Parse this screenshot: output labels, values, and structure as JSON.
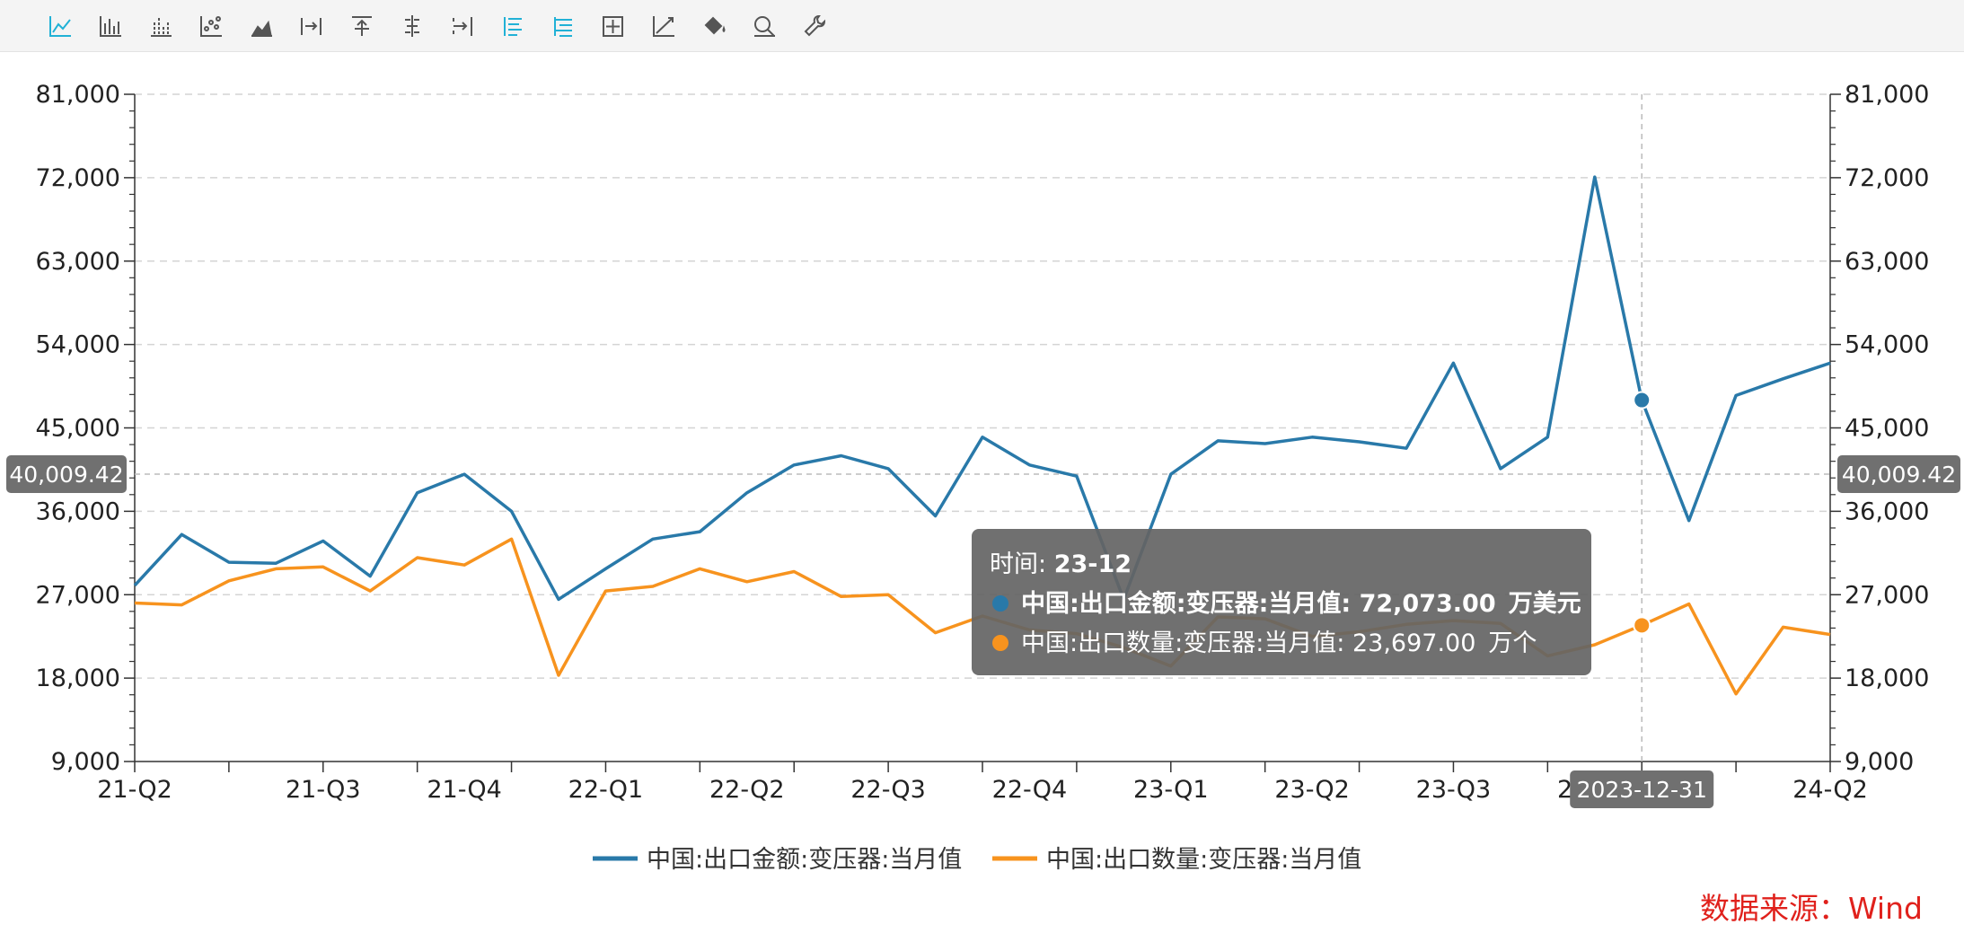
{
  "toolbar": {
    "buttons": [
      {
        "name": "line-chart-icon",
        "active": true
      },
      {
        "name": "bar-chart-icon",
        "active": false
      },
      {
        "name": "stacked-bar-icon",
        "active": false
      },
      {
        "name": "scatter-chart-icon",
        "active": false
      },
      {
        "name": "area-chart-icon",
        "active": false
      },
      {
        "name": "align-right-icon",
        "active": false
      },
      {
        "name": "align-top-icon",
        "active": false
      },
      {
        "name": "align-center-icon",
        "active": false
      },
      {
        "name": "align-end-icon",
        "active": false
      },
      {
        "name": "list-left-icon",
        "active": true
      },
      {
        "name": "list-right-icon",
        "active": true
      },
      {
        "name": "crosshair-box-icon",
        "active": false
      },
      {
        "name": "trend-line-icon",
        "active": false
      },
      {
        "name": "fill-bucket-icon",
        "active": false
      },
      {
        "name": "zoom-icon",
        "active": false
      },
      {
        "name": "wrench-icon",
        "active": false
      }
    ]
  },
  "chart_data": {
    "type": "line",
    "x": [
      "21-04",
      "21-05",
      "21-06",
      "21-07",
      "21-08",
      "21-09",
      "21-10",
      "21-11",
      "21-12",
      "22-01",
      "22-02",
      "22-03",
      "22-04",
      "22-05",
      "22-06",
      "22-07",
      "22-08",
      "22-09",
      "22-10",
      "22-11",
      "22-12",
      "23-01",
      "23-02",
      "23-03",
      "23-04",
      "23-05",
      "23-06",
      "23-07",
      "23-08",
      "23-09",
      "23-10",
      "23-11",
      "23-12",
      "24-01",
      "24-02",
      "24-03",
      "24-04"
    ],
    "x_tick_labels": [
      "21-Q2",
      "21-Q3",
      "21-Q4",
      "22-Q1",
      "22-Q2",
      "22-Q3",
      "22-Q4",
      "23-Q1",
      "23-Q2",
      "23-Q3",
      "23-Q4",
      "24-Q2"
    ],
    "x_tick_positions": [
      "21-04",
      "21-08",
      "21-11",
      "22-02",
      "22-05",
      "22-08",
      "22-11",
      "23-02",
      "23-05",
      "23-08",
      "23-11",
      "24-04"
    ],
    "y_left": {
      "min": 9000,
      "max": 81000,
      "ticks": [
        "9,000",
        "18,000",
        "27,000",
        "36,000",
        "45,000",
        "54,000",
        "63,000",
        "72,000",
        "81,000"
      ]
    },
    "y_right": {
      "min": 9000,
      "max": 81000,
      "ticks": [
        "9,000",
        "18,000",
        "27,000",
        "36,000",
        "45,000",
        "54,000",
        "63,000",
        "72,000",
        "81,000"
      ]
    },
    "series": [
      {
        "name": "中国:出口金额:变压器:当月值",
        "color": "#2979a9",
        "values": [
          28000,
          33500,
          30500,
          30400,
          32800,
          29000,
          38000,
          40000,
          36000,
          26500,
          29800,
          33000,
          33800,
          38000,
          41000,
          42000,
          40600,
          35500,
          44000,
          41000,
          39800,
          26500,
          40000,
          43600,
          43300,
          44000,
          43500,
          42800,
          52000,
          40600,
          44000,
          72073,
          48000,
          35000,
          48500,
          50300,
          52000
        ]
      },
      {
        "name": "中国:出口数量:变压器:当月值",
        "color": "#f7931e",
        "values": [
          26100,
          25900,
          28500,
          29800,
          30000,
          27400,
          31000,
          30200,
          33000,
          18300,
          27400,
          27900,
          29800,
          28400,
          29500,
          26800,
          27000,
          22900,
          24700,
          23200,
          22800,
          21300,
          19300,
          24600,
          24400,
          22500,
          23000,
          23800,
          24200,
          23900,
          20400,
          21600,
          23697,
          26000,
          16300,
          23500,
          22700
        ]
      }
    ],
    "hover": {
      "index": 32,
      "x_label": "2023-12-31",
      "crosshair_value_left": "40,009.42",
      "crosshair_value_right": "40,009.42"
    }
  },
  "tooltip": {
    "time_label": "时间: ",
    "time_value": "23-12",
    "rows": [
      {
        "label": "中国:出口金额:变压器:当月值: ",
        "value": "72,073.00",
        "unit": "万美元",
        "color": "#2979a9"
      },
      {
        "label": "中国:出口数量:变压器:当月值: ",
        "value": "23,697.00",
        "unit": "万个",
        "color": "#f7931e"
      }
    ]
  },
  "source_text": "数据来源：Wind"
}
